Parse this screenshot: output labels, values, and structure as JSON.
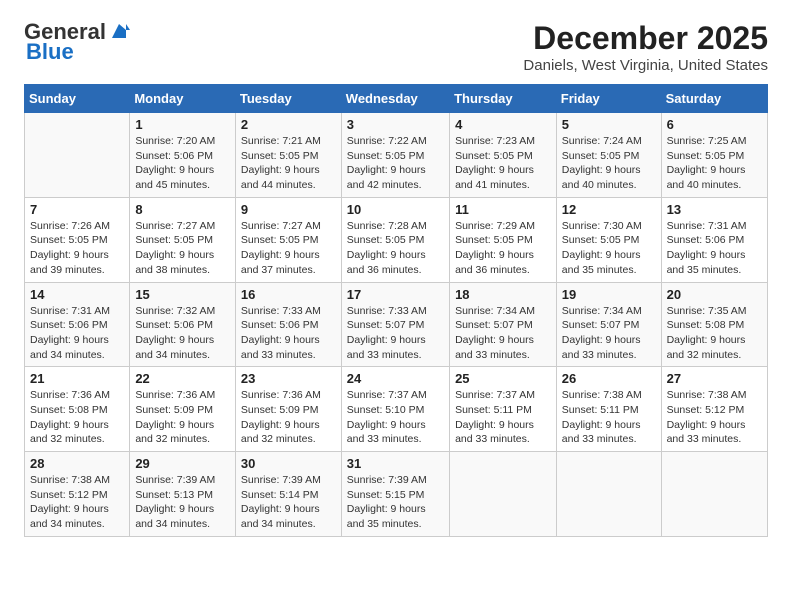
{
  "header": {
    "logo_general": "General",
    "logo_blue": "Blue",
    "title": "December 2025",
    "subtitle": "Daniels, West Virginia, United States"
  },
  "days_of_week": [
    "Sunday",
    "Monday",
    "Tuesday",
    "Wednesday",
    "Thursday",
    "Friday",
    "Saturday"
  ],
  "weeks": [
    [
      {
        "num": "",
        "detail": ""
      },
      {
        "num": "1",
        "detail": "Sunrise: 7:20 AM\nSunset: 5:06 PM\nDaylight: 9 hours\nand 45 minutes."
      },
      {
        "num": "2",
        "detail": "Sunrise: 7:21 AM\nSunset: 5:05 PM\nDaylight: 9 hours\nand 44 minutes."
      },
      {
        "num": "3",
        "detail": "Sunrise: 7:22 AM\nSunset: 5:05 PM\nDaylight: 9 hours\nand 42 minutes."
      },
      {
        "num": "4",
        "detail": "Sunrise: 7:23 AM\nSunset: 5:05 PM\nDaylight: 9 hours\nand 41 minutes."
      },
      {
        "num": "5",
        "detail": "Sunrise: 7:24 AM\nSunset: 5:05 PM\nDaylight: 9 hours\nand 40 minutes."
      },
      {
        "num": "6",
        "detail": "Sunrise: 7:25 AM\nSunset: 5:05 PM\nDaylight: 9 hours\nand 40 minutes."
      }
    ],
    [
      {
        "num": "7",
        "detail": "Sunrise: 7:26 AM\nSunset: 5:05 PM\nDaylight: 9 hours\nand 39 minutes."
      },
      {
        "num": "8",
        "detail": "Sunrise: 7:27 AM\nSunset: 5:05 PM\nDaylight: 9 hours\nand 38 minutes."
      },
      {
        "num": "9",
        "detail": "Sunrise: 7:27 AM\nSunset: 5:05 PM\nDaylight: 9 hours\nand 37 minutes."
      },
      {
        "num": "10",
        "detail": "Sunrise: 7:28 AM\nSunset: 5:05 PM\nDaylight: 9 hours\nand 36 minutes."
      },
      {
        "num": "11",
        "detail": "Sunrise: 7:29 AM\nSunset: 5:05 PM\nDaylight: 9 hours\nand 36 minutes."
      },
      {
        "num": "12",
        "detail": "Sunrise: 7:30 AM\nSunset: 5:05 PM\nDaylight: 9 hours\nand 35 minutes."
      },
      {
        "num": "13",
        "detail": "Sunrise: 7:31 AM\nSunset: 5:06 PM\nDaylight: 9 hours\nand 35 minutes."
      }
    ],
    [
      {
        "num": "14",
        "detail": "Sunrise: 7:31 AM\nSunset: 5:06 PM\nDaylight: 9 hours\nand 34 minutes."
      },
      {
        "num": "15",
        "detail": "Sunrise: 7:32 AM\nSunset: 5:06 PM\nDaylight: 9 hours\nand 34 minutes."
      },
      {
        "num": "16",
        "detail": "Sunrise: 7:33 AM\nSunset: 5:06 PM\nDaylight: 9 hours\nand 33 minutes."
      },
      {
        "num": "17",
        "detail": "Sunrise: 7:33 AM\nSunset: 5:07 PM\nDaylight: 9 hours\nand 33 minutes."
      },
      {
        "num": "18",
        "detail": "Sunrise: 7:34 AM\nSunset: 5:07 PM\nDaylight: 9 hours\nand 33 minutes."
      },
      {
        "num": "19",
        "detail": "Sunrise: 7:34 AM\nSunset: 5:07 PM\nDaylight: 9 hours\nand 33 minutes."
      },
      {
        "num": "20",
        "detail": "Sunrise: 7:35 AM\nSunset: 5:08 PM\nDaylight: 9 hours\nand 32 minutes."
      }
    ],
    [
      {
        "num": "21",
        "detail": "Sunrise: 7:36 AM\nSunset: 5:08 PM\nDaylight: 9 hours\nand 32 minutes."
      },
      {
        "num": "22",
        "detail": "Sunrise: 7:36 AM\nSunset: 5:09 PM\nDaylight: 9 hours\nand 32 minutes."
      },
      {
        "num": "23",
        "detail": "Sunrise: 7:36 AM\nSunset: 5:09 PM\nDaylight: 9 hours\nand 32 minutes."
      },
      {
        "num": "24",
        "detail": "Sunrise: 7:37 AM\nSunset: 5:10 PM\nDaylight: 9 hours\nand 33 minutes."
      },
      {
        "num": "25",
        "detail": "Sunrise: 7:37 AM\nSunset: 5:11 PM\nDaylight: 9 hours\nand 33 minutes."
      },
      {
        "num": "26",
        "detail": "Sunrise: 7:38 AM\nSunset: 5:11 PM\nDaylight: 9 hours\nand 33 minutes."
      },
      {
        "num": "27",
        "detail": "Sunrise: 7:38 AM\nSunset: 5:12 PM\nDaylight: 9 hours\nand 33 minutes."
      }
    ],
    [
      {
        "num": "28",
        "detail": "Sunrise: 7:38 AM\nSunset: 5:12 PM\nDaylight: 9 hours\nand 34 minutes."
      },
      {
        "num": "29",
        "detail": "Sunrise: 7:39 AM\nSunset: 5:13 PM\nDaylight: 9 hours\nand 34 minutes."
      },
      {
        "num": "30",
        "detail": "Sunrise: 7:39 AM\nSunset: 5:14 PM\nDaylight: 9 hours\nand 34 minutes."
      },
      {
        "num": "31",
        "detail": "Sunrise: 7:39 AM\nSunset: 5:15 PM\nDaylight: 9 hours\nand 35 minutes."
      },
      {
        "num": "",
        "detail": ""
      },
      {
        "num": "",
        "detail": ""
      },
      {
        "num": "",
        "detail": ""
      }
    ]
  ]
}
